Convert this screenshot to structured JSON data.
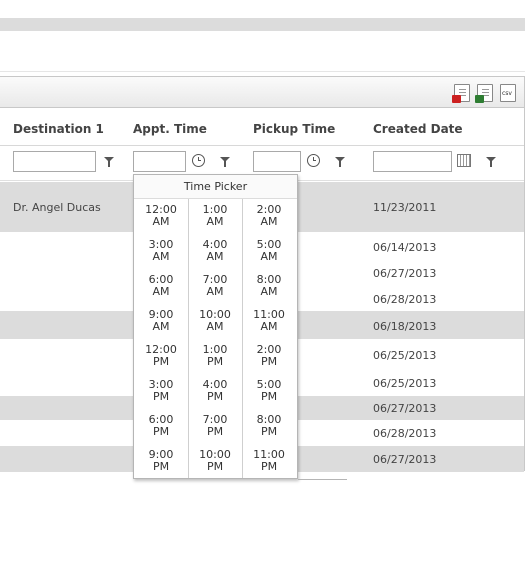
{
  "export": {
    "pdf_icon": "pdf-file-icon",
    "excel_icon": "excel-file-icon",
    "csv_icon": "csv-file-icon",
    "csv_label": "csv"
  },
  "columns": {
    "destination": "Destination 1",
    "appt_time": "Appt. Time",
    "pickup_time": "Pickup Time",
    "created_date": "Created Date"
  },
  "filters": {
    "destination_value": "",
    "appt_time_value": "",
    "pickup_time_value": "",
    "created_date_value": ""
  },
  "rows": [
    {
      "destination": "Dr. Angel Ducas",
      "created": "11/23/2011"
    },
    {
      "destination": "",
      "created": "06/14/2013"
    },
    {
      "destination": "",
      "created": "06/27/2013"
    },
    {
      "destination": "",
      "created": "06/28/2013"
    },
    {
      "destination": "",
      "created": "06/18/2013"
    },
    {
      "destination": "",
      "created": "06/25/2013"
    },
    {
      "destination": "",
      "created": "06/25/2013"
    },
    {
      "destination": "",
      "created": "06/27/2013"
    },
    {
      "destination": "",
      "created": "06/28/2013"
    },
    {
      "destination": "",
      "created": "06/27/2013"
    }
  ],
  "time_picker": {
    "title": "Time Picker",
    "times": [
      {
        "t": "12:00",
        "p": "AM"
      },
      {
        "t": "1:00",
        "p": "AM"
      },
      {
        "t": "2:00",
        "p": "AM"
      },
      {
        "t": "3:00",
        "p": "AM"
      },
      {
        "t": "4:00",
        "p": "AM"
      },
      {
        "t": "5:00",
        "p": "AM"
      },
      {
        "t": "6:00",
        "p": "AM"
      },
      {
        "t": "7:00",
        "p": "AM"
      },
      {
        "t": "8:00",
        "p": "AM"
      },
      {
        "t": "9:00",
        "p": "AM"
      },
      {
        "t": "10:00",
        "p": "AM"
      },
      {
        "t": "11:00",
        "p": "AM"
      },
      {
        "t": "12:00",
        "p": "PM"
      },
      {
        "t": "1:00",
        "p": "PM"
      },
      {
        "t": "2:00",
        "p": "PM"
      },
      {
        "t": "3:00",
        "p": "PM"
      },
      {
        "t": "4:00",
        "p": "PM"
      },
      {
        "t": "5:00",
        "p": "PM"
      },
      {
        "t": "6:00",
        "p": "PM"
      },
      {
        "t": "7:00",
        "p": "PM"
      },
      {
        "t": "8:00",
        "p": "PM"
      },
      {
        "t": "9:00",
        "p": "PM"
      },
      {
        "t": "10:00",
        "p": "PM"
      },
      {
        "t": "11:00",
        "p": "PM"
      }
    ]
  },
  "colors": {
    "header_bg": "#f3f3f3",
    "alt_row_bg": "#dcdcdc",
    "pdf_red": "#cc2020",
    "excel_green": "#2e7d32"
  }
}
